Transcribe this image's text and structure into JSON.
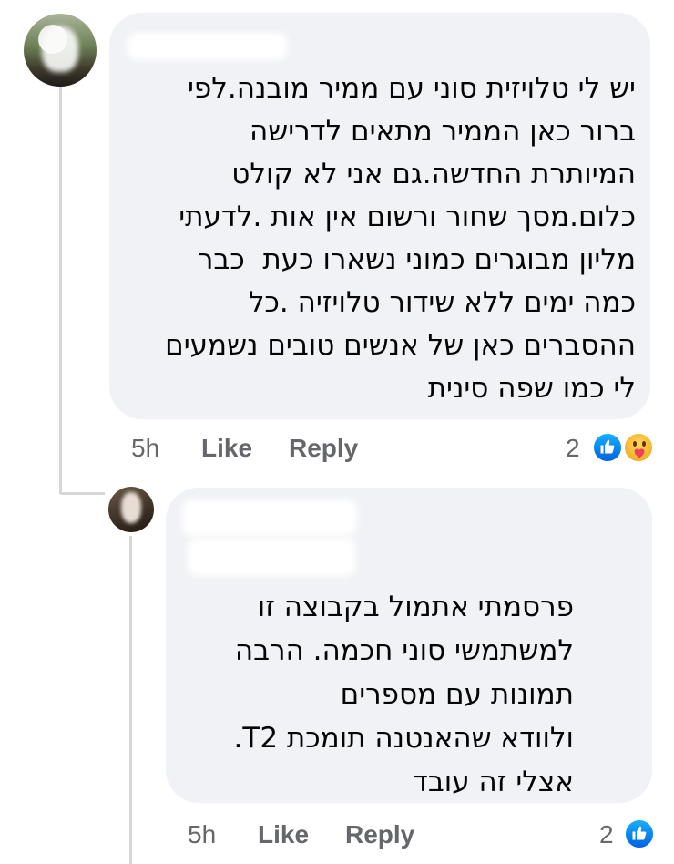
{
  "comment": {
    "author_name": "",
    "text": "יש לי טלויזית סוני עם ממיר מובנה.לפי\nברור כאן הממיר מתאים לדרישה\nהמיותרת החדשה.גם אני לא קולט\nכלום.מסך שחור ורשום אין אות .לדעתי\nמליון מבוגרים כמוני נשארו כעת  כבר\nכמה ימים ללא שידור טלויזיה .כל\nההסברים כאן של אנשים טובים נשמעים\nלי כמו שפה סינית",
    "time": "5h",
    "like_label": "Like",
    "reply_label": "Reply",
    "reaction_count": "2",
    "reactions": [
      "like-icon",
      "care-icon"
    ]
  },
  "reply": {
    "author_name": "",
    "text": "פרסמתי אתמול בקבוצה זו\nלמשתמשי סוני חכמה. הרבה\nתמונות עם מספרים \nולוודא שהאנטנה תומכת T2.\nאצלי זה עובד",
    "time": "5h",
    "like_label": "Like",
    "reply_label": "Reply",
    "reaction_count": "2",
    "reactions": [
      "like-icon"
    ]
  },
  "colors": {
    "bubble": "#f0f2f5",
    "meta_text": "#65676b",
    "like_blue": "#1877f2",
    "thread_line": "#d4d6da"
  }
}
